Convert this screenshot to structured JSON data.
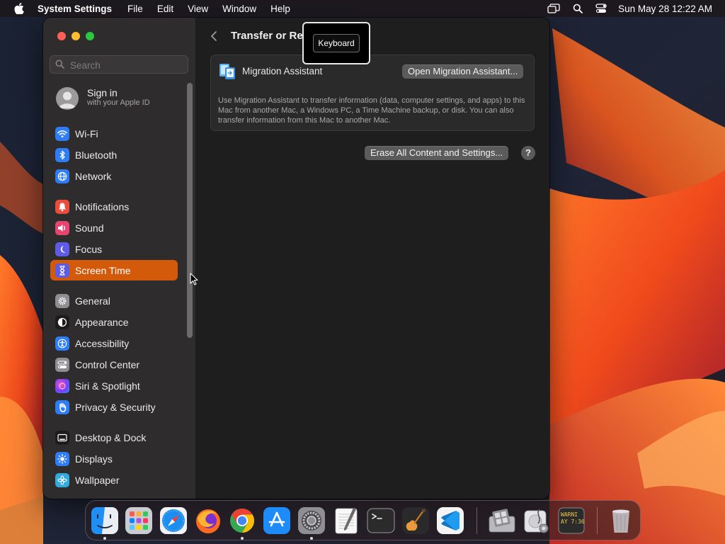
{
  "menubar": {
    "app_name": "System Settings",
    "menus": [
      "File",
      "Edit",
      "View",
      "Window",
      "Help"
    ],
    "clock": "Sun May 28  12:22 AM",
    "status_icons": [
      "screen-mirroring-icon",
      "spotlight-search-icon",
      "control-center-icon"
    ]
  },
  "sidebar": {
    "search_placeholder": "Search",
    "account": {
      "name": "Sign in",
      "subtitle": "with your Apple ID"
    },
    "items": [
      {
        "label": "Wi-Fi",
        "icon": "wifi-icon",
        "color": "#2f7df6",
        "active": false
      },
      {
        "label": "Bluetooth",
        "icon": "bluetooth-icon",
        "color": "#2f7df6",
        "active": false
      },
      {
        "label": "Network",
        "icon": "globe-icon",
        "color": "#2f7df6",
        "active": false
      },
      {
        "label": "Notifications",
        "icon": "bell-icon",
        "color": "#eb4d3d",
        "active": false
      },
      {
        "label": "Sound",
        "icon": "speaker-icon",
        "color": "#e64570",
        "active": false
      },
      {
        "label": "Focus",
        "icon": "moon-icon",
        "color": "#5e5ce6",
        "active": false
      },
      {
        "label": "Screen Time",
        "icon": "hourglass-icon",
        "color": "#5e5ce6",
        "active": true
      },
      {
        "label": "General",
        "icon": "gear-icon",
        "color": "#8e8e93",
        "active": false
      },
      {
        "label": "Appearance",
        "icon": "appearance-icon",
        "color": "#1c1c1e",
        "active": false
      },
      {
        "label": "Accessibility",
        "icon": "accessibility-icon",
        "color": "#2f7df6",
        "active": false
      },
      {
        "label": "Control Center",
        "icon": "control-center-icon",
        "color": "#8e8e93",
        "active": false
      },
      {
        "label": "Siri & Spotlight",
        "icon": "siri-icon",
        "color": "#b04ad6",
        "active": false
      },
      {
        "label": "Privacy & Security",
        "icon": "hand-icon",
        "color": "#2f7df6",
        "active": false
      },
      {
        "label": "Desktop & Dock",
        "icon": "dock-icon",
        "color": "#1c1c1e",
        "active": false
      },
      {
        "label": "Displays",
        "icon": "sun-icon",
        "color": "#2f7df6",
        "active": false
      },
      {
        "label": "Wallpaper",
        "icon": "wallpaper-icon",
        "color": "#34aadc",
        "active": false
      }
    ]
  },
  "main": {
    "title": "Transfer or Re",
    "migration": {
      "label": "Migration Assistant",
      "button": "Open Migration Assistant...",
      "description": "Use Migration Assistant to transfer information (data, computer settings, and apps) to this Mac from another Mac, a Windows PC, a Time Machine backup, or disk. You can also transfer information from this Mac to another Mac."
    },
    "erase_button": "Erase All Content and Settings...",
    "help_label": "?"
  },
  "tooltip": {
    "label": "Keyboard"
  },
  "dock": {
    "apps": [
      {
        "name": "Finder",
        "icon": "finder-icon",
        "running": true
      },
      {
        "name": "Launchpad",
        "icon": "launchpad-icon",
        "running": false
      },
      {
        "name": "Safari",
        "icon": "safari-icon",
        "running": false
      },
      {
        "name": "Firefox",
        "icon": "firefox-icon",
        "running": false
      },
      {
        "name": "Chrome",
        "icon": "chrome-icon",
        "running": true
      },
      {
        "name": "App Store",
        "icon": "app-store-icon",
        "running": false
      },
      {
        "name": "System Settings",
        "icon": "system-settings-icon",
        "running": true
      },
      {
        "name": "TextEdit",
        "icon": "textedit-icon",
        "running": false
      },
      {
        "name": "Terminal",
        "icon": "terminal-icon",
        "running": false
      },
      {
        "name": "GarageBand",
        "icon": "garageband-icon",
        "running": false
      },
      {
        "name": "Visual Studio Code",
        "icon": "vscode-icon",
        "running": false
      },
      {
        "name": "Boot Camp Assistant",
        "icon": "bootcamp-icon",
        "running": false
      },
      {
        "name": "Disk Utility",
        "icon": "disk-utility-icon",
        "running": false
      },
      {
        "name": "Console",
        "icon": "console-icon",
        "running": false
      },
      {
        "name": "Trash",
        "icon": "trash-icon",
        "running": false
      }
    ],
    "console_text": "WARNI\nAY 7:36"
  }
}
